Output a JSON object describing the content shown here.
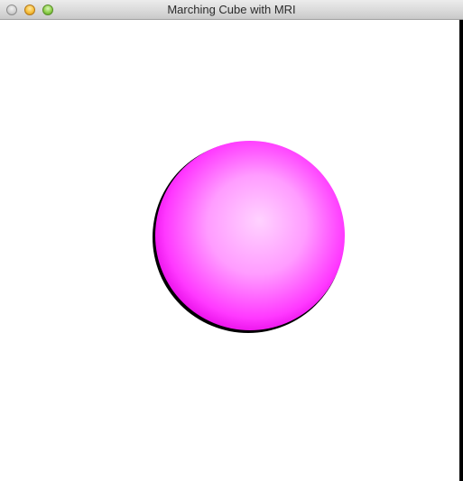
{
  "window": {
    "title": "Marching Cube with MRI"
  },
  "render": {
    "background_color": "#ffffff",
    "object": "sphere",
    "object_color": "#ff35ff",
    "highlight_color": "#ffd2ff",
    "shadow_color": "#000000"
  }
}
